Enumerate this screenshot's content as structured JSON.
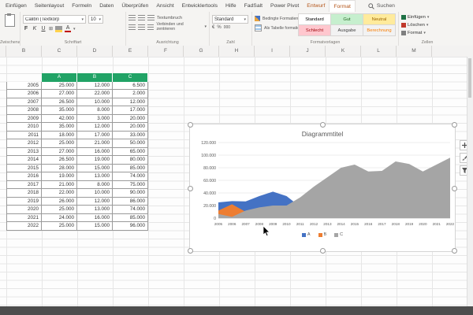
{
  "window": {
    "search_label": "Suchen"
  },
  "ribbon": {
    "tabs": [
      {
        "label": "Einfügen",
        "style": "normal"
      },
      {
        "label": "Seitenlayout",
        "style": "normal"
      },
      {
        "label": "Formeln",
        "style": "normal"
      },
      {
        "label": "Daten",
        "style": "normal"
      },
      {
        "label": "Überprüfen",
        "style": "normal"
      },
      {
        "label": "Ansicht",
        "style": "normal"
      },
      {
        "label": "Entwicklertools",
        "style": "normal"
      },
      {
        "label": "Hilfe",
        "style": "normal"
      },
      {
        "label": "FadSalt",
        "style": "normal"
      },
      {
        "label": "Power Pivot",
        "style": "normal"
      },
      {
        "label": "Entwurf",
        "style": "contextual"
      },
      {
        "label": "Format",
        "style": "contextual-selected"
      }
    ],
    "clipboard_group": {
      "label": "Zwischenablage"
    },
    "font_group": {
      "label": "Schriftart",
      "font_name": "Calibri (Textkörp",
      "font_size": "10",
      "bold": "F",
      "italic": "K",
      "underline": "U"
    },
    "alignment_group": {
      "label": "Ausrichtung",
      "wrap_text": "Textumbruch",
      "merge_center": "Verbinden und zentrieren"
    },
    "number_group": {
      "label": "Zahl",
      "format": "Standard"
    },
    "styles_group": {
      "label": "Formatvorlagen",
      "conditional": "Bedingte Formatierung",
      "format_table": "Als Tabelle formatieren",
      "styles": [
        {
          "label": "Standard",
          "bg": "#ffffff",
          "fg": "#000000"
        },
        {
          "label": "Gut",
          "bg": "#c6efce",
          "fg": "#276b24"
        },
        {
          "label": "Neutral",
          "bg": "#ffeb9c",
          "fg": "#9c6500"
        },
        {
          "label": "Schlecht",
          "bg": "#ffc7ce",
          "fg": "#9c0006"
        },
        {
          "label": "Ausgabe",
          "bg": "#f2f2f2",
          "fg": "#3f3f3f"
        },
        {
          "label": "Berechnung",
          "bg": "#f2f2f2",
          "fg": "#fa7d00"
        }
      ]
    },
    "cells_group": {
      "label": "Zellen",
      "buttons": [
        {
          "label": "Einfügen",
          "accent": "#1e7145"
        },
        {
          "label": "Löschen",
          "accent": "#c0392b"
        },
        {
          "label": "Format",
          "accent": "#7f7f7f"
        }
      ]
    }
  },
  "sheet": {
    "columns": [
      "B",
      "C",
      "D",
      "E",
      "F",
      "G",
      "H",
      "I",
      "J",
      "K",
      "L",
      "M"
    ],
    "table": {
      "header_bg": "#21a366",
      "headers": [
        "A",
        "B",
        "C"
      ],
      "rows": [
        [
          "2005",
          "25.000",
          "12.000",
          "6.500"
        ],
        [
          "2006",
          "27.000",
          "22.000",
          "2.000"
        ],
        [
          "2007",
          "26.500",
          "10.000",
          "12.000"
        ],
        [
          "2008",
          "35.000",
          "8.000",
          "17.000"
        ],
        [
          "2009",
          "42.000",
          "3.000",
          "20.000"
        ],
        [
          "2010",
          "35.000",
          "12.000",
          "20.000"
        ],
        [
          "2011",
          "18.000",
          "17.000",
          "33.000"
        ],
        [
          "2012",
          "25.000",
          "21.000",
          "50.000"
        ],
        [
          "2013",
          "27.000",
          "16.000",
          "65.000"
        ],
        [
          "2014",
          "26.500",
          "19.000",
          "80.000"
        ],
        [
          "2015",
          "28.000",
          "15.000",
          "85.000"
        ],
        [
          "2016",
          "19.000",
          "13.000",
          "74.000"
        ],
        [
          "2017",
          "21.000",
          "8.000",
          "75.000"
        ],
        [
          "2018",
          "22.000",
          "10.000",
          "90.000"
        ],
        [
          "2019",
          "26.000",
          "12.000",
          "86.000"
        ],
        [
          "2020",
          "25.000",
          "13.000",
          "74.000"
        ],
        [
          "2021",
          "24.000",
          "16.000",
          "85.000"
        ],
        [
          "2022",
          "25.000",
          "15.000",
          "96.000"
        ]
      ]
    }
  },
  "chart_data": {
    "type": "area",
    "title": "Diagrammtitel",
    "x": [
      "2005",
      "2006",
      "2007",
      "2008",
      "2009",
      "2010",
      "2011",
      "2012",
      "2013",
      "2014",
      "2015",
      "2016",
      "2017",
      "2018",
      "2019",
      "2020",
      "2021",
      "2022"
    ],
    "series": [
      {
        "name": "A",
        "color": "#4472c4",
        "values": [
          25000,
          27000,
          26500,
          35000,
          42000,
          35000,
          18000,
          25000,
          27000,
          26500,
          28000,
          19000,
          21000,
          22000,
          26000,
          25000,
          24000,
          25000
        ]
      },
      {
        "name": "B",
        "color": "#ed7d31",
        "values": [
          12000,
          22000,
          10000,
          8000,
          3000,
          12000,
          17000,
          21000,
          16000,
          19000,
          15000,
          13000,
          8000,
          10000,
          12000,
          13000,
          16000,
          15000
        ]
      },
      {
        "name": "C",
        "color": "#a5a5a5",
        "values": [
          6500,
          2000,
          12000,
          17000,
          20000,
          20000,
          33000,
          50000,
          65000,
          80000,
          85000,
          74000,
          75000,
          90000,
          86000,
          74000,
          85000,
          96000
        ]
      }
    ],
    "ylim": [
      0,
      120000
    ],
    "yticks": [
      {
        "v": 0,
        "label": "0"
      },
      {
        "v": 20000,
        "label": "20.000"
      },
      {
        "v": 40000,
        "label": "40.000"
      },
      {
        "v": 60000,
        "label": "60.000"
      },
      {
        "v": 80000,
        "label": "80.000"
      },
      {
        "v": 100000,
        "label": "100.000"
      },
      {
        "v": 120000,
        "label": "120.000"
      }
    ],
    "legend_position": "bottom",
    "grid": true
  }
}
